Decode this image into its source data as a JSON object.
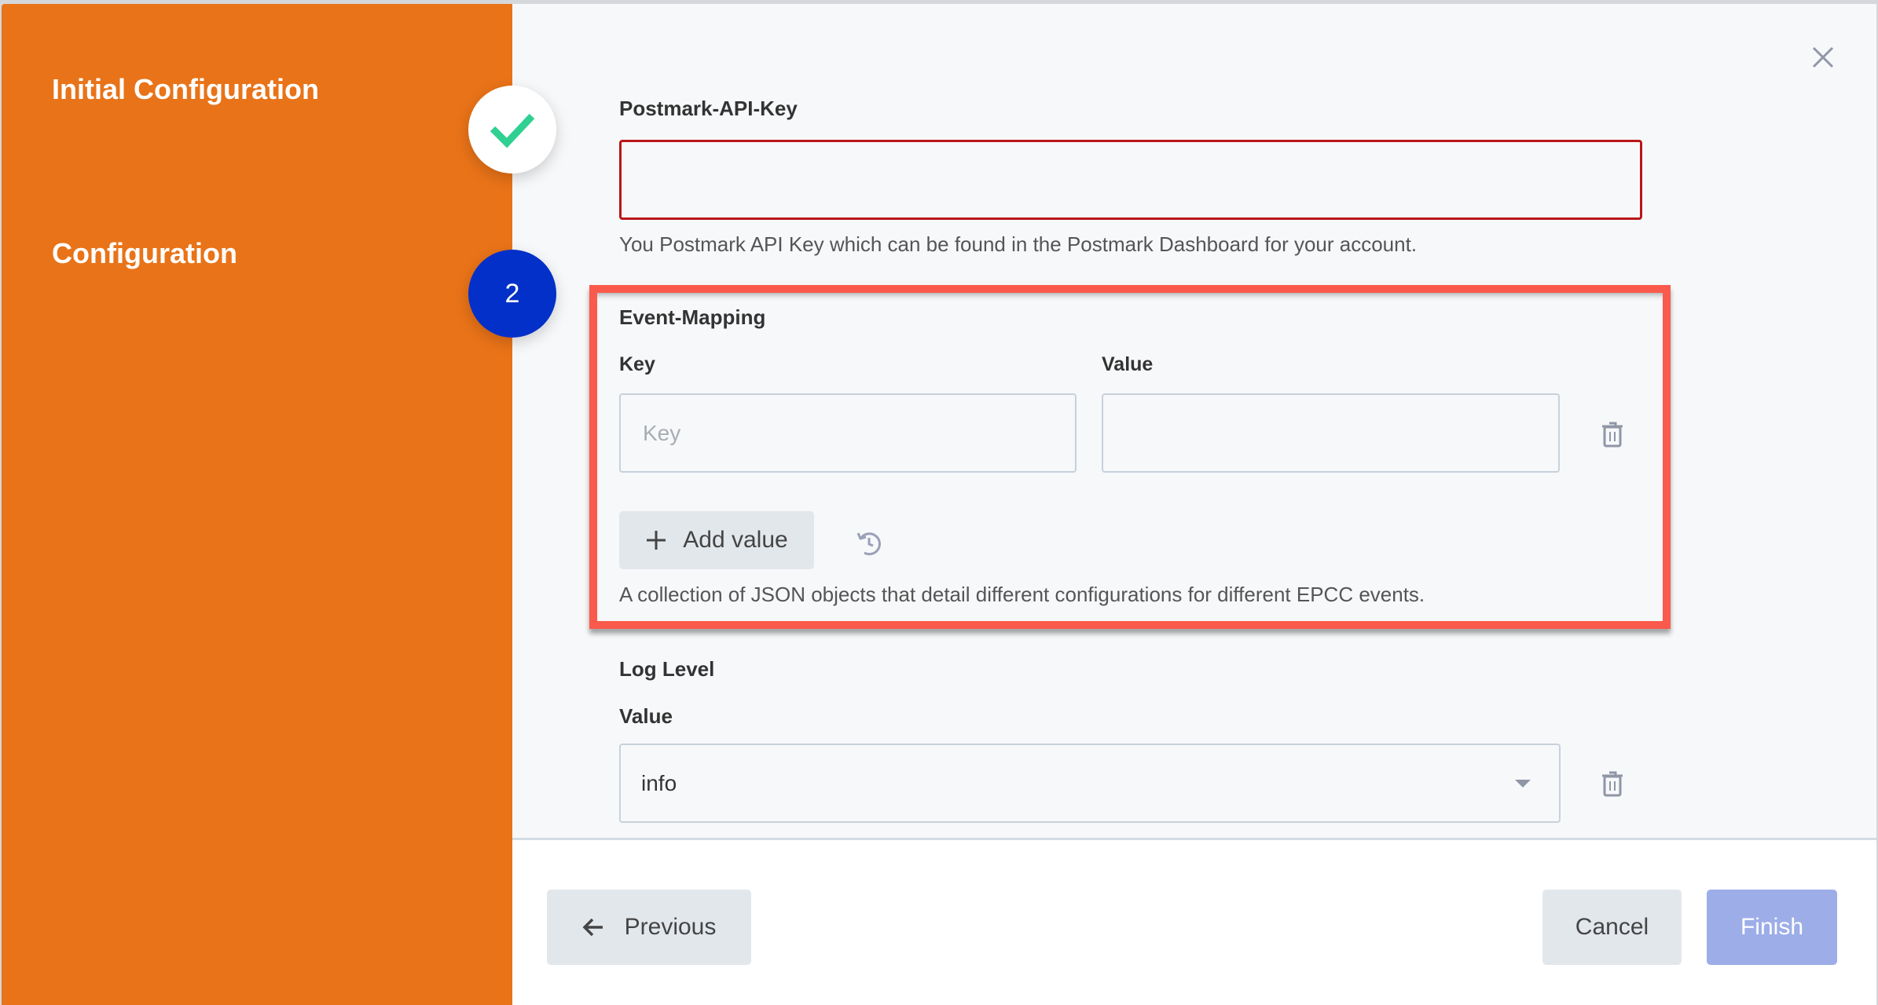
{
  "wizard": {
    "steps": [
      {
        "label": "Initial Configuration",
        "status": "complete",
        "icon": "check-icon"
      },
      {
        "label": "Configuration",
        "status": "active",
        "number": "2"
      }
    ]
  },
  "form": {
    "postmark_api_key": {
      "label": "Postmark-API-Key",
      "value": "",
      "help": "You Postmark API Key which can be found in the Postmark Dashboard for your account."
    },
    "event_mapping": {
      "label": "Event-Mapping",
      "key_label": "Key",
      "value_label": "Value",
      "key_placeholder": "Key",
      "key_value": "",
      "value_value": "",
      "add_value_label": "Add value",
      "help": "A collection of JSON objects that detail different configurations for different EPCC events."
    },
    "log_level": {
      "label": "Log Level",
      "value_label": "Value",
      "selected": "info"
    }
  },
  "footer": {
    "previous_label": "Previous",
    "cancel_label": "Cancel",
    "finish_label": "Finish"
  },
  "colors": {
    "sidebar": "#e97318",
    "active_step": "#0230c8",
    "complete_check": "#30d092",
    "highlight": "#fa5a4c",
    "error_border": "#b9161a",
    "finish_disabled": "#9dade8"
  }
}
